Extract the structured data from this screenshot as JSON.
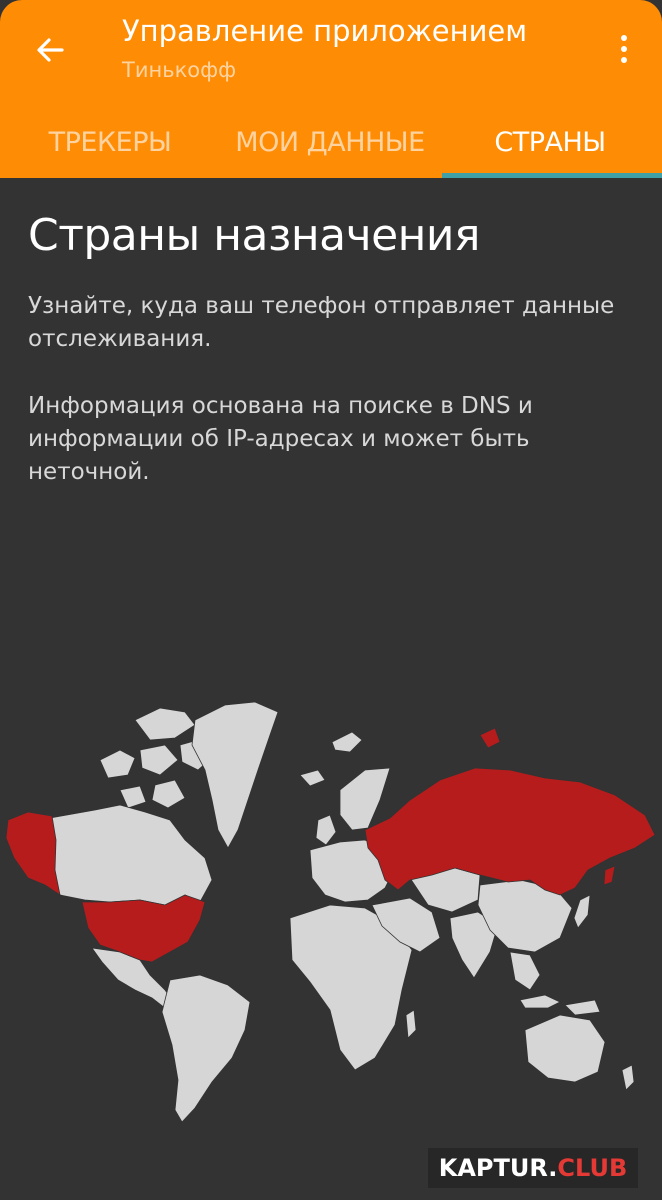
{
  "app_bar": {
    "title": "Управление приложением",
    "subtitle": "Тинькофф",
    "back_icon": "arrow-left-icon",
    "menu_icon": "more-vertical-icon"
  },
  "tabs": [
    {
      "label": "ТРЕКЕРЫ",
      "selected": false
    },
    {
      "label": "МОИ ДАННЫЕ",
      "selected": false
    },
    {
      "label": "СТРАНЫ",
      "selected": true
    }
  ],
  "content": {
    "heading": "Страны назначения",
    "paragraph1": "Узнайте, куда ваш телефон отправляет данные отслеживания.",
    "paragraph2": "Информация основана на поиске в DNS и информации об IP-адресах и может быть неточной."
  },
  "map": {
    "highlighted_countries": [
      "Alaska (USA)",
      "United States",
      "Russia"
    ]
  },
  "watermark": {
    "text_main": "KAPTUR.",
    "text_accent": "CLUB"
  },
  "colors": {
    "accent": "#FF8C05",
    "tab_indicator": "#3FA0A8",
    "background": "#333333",
    "land": "#D6D6D6",
    "highlight": "#B71C1C"
  }
}
